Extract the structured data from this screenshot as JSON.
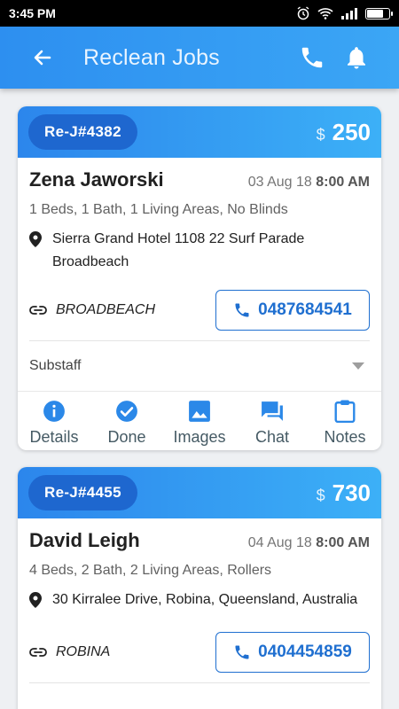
{
  "status_bar": {
    "time": "3:45 PM"
  },
  "app_bar": {
    "title": "Reclean Jobs"
  },
  "colors": {
    "primary": "#2d8ff0",
    "pill": "#1e67cf",
    "accent_blue": "#1f6fd0",
    "icon_blue": "#2b88e8"
  },
  "icons": [
    "arrow-left-icon",
    "phone-icon",
    "bell-icon",
    "location-pin-icon",
    "link-icon",
    "info-icon",
    "check-circle-icon",
    "image-icon",
    "chat-icon",
    "clipboard-icon",
    "dropdown-arrow-icon"
  ],
  "jobs": [
    {
      "job_id": "Re-J#4382",
      "currency": "$",
      "amount": "250",
      "client_name": "Zena Jaworski",
      "date": "03 Aug 18",
      "time": "8:00 AM",
      "description": "1 Beds, 1 Bath, 1 Living Areas, No Blinds",
      "address": "Sierra Grand Hotel 1108 22 Surf Parade Broadbeach",
      "suburb": "BROADBEACH",
      "phone": "0487684541",
      "substaff": "Substaff",
      "actions": {
        "details": "Details",
        "done": "Done",
        "images": "Images",
        "chat": "Chat",
        "notes": "Notes"
      }
    },
    {
      "job_id": "Re-J#4455",
      "currency": "$",
      "amount": "730",
      "client_name": "David Leigh",
      "date": "04 Aug 18",
      "time": "8:00 AM",
      "description": "4 Beds, 2 Bath, 2 Living Areas, Rollers",
      "address": "30 Kirralee Drive, Robina, Queensland, Australia",
      "suburb": "ROBINA",
      "phone": "0404454859"
    }
  ]
}
